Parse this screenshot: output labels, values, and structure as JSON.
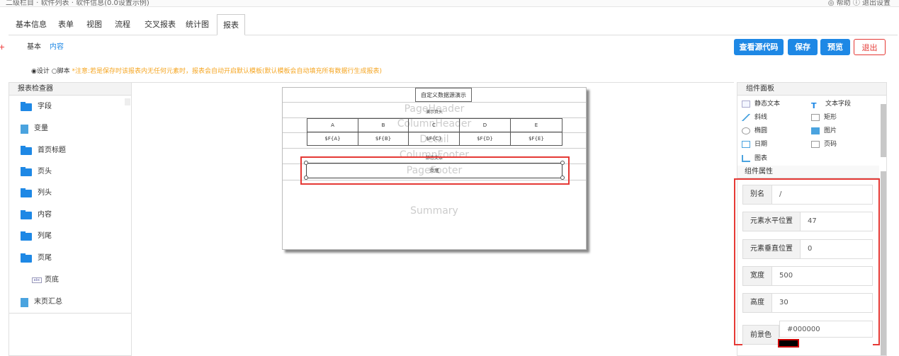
{
  "topbar": {
    "crumb": "二级栏目 · 软件列表 · 软件信息(0.0设置示例)",
    "right": "◎ 帮助 ⓘ 退出设置"
  },
  "side_mark": "+",
  "tabs": [
    "基本信息",
    "表单",
    "视图",
    "流程",
    "交叉报表",
    "统计图",
    "报表"
  ],
  "active_tab": "报表",
  "subtabs": [
    "基本",
    "内容"
  ],
  "buttons": {
    "source": "查看源代码",
    "save": "保存",
    "preview": "预览",
    "exit": "退出"
  },
  "mode": {
    "design": "◉设计",
    "script": "○脚本",
    "notice": "*注意:若是保存时该报表内无任何元素时，报表会自动开启默认模板(默认模板会自动填充所有数据行生成报表)"
  },
  "inspector": {
    "title": "报表检查器",
    "items": [
      {
        "label": "字段",
        "icon": "folder-icon"
      },
      {
        "label": "变量",
        "icon": "document-icon"
      },
      {
        "label": "首页标题",
        "icon": "folder-icon"
      },
      {
        "label": "页头",
        "icon": "folder-icon"
      },
      {
        "label": "列头",
        "icon": "folder-icon"
      },
      {
        "label": "内容",
        "icon": "folder-icon"
      },
      {
        "label": "列尾",
        "icon": "folder-icon"
      },
      {
        "label": "页尾",
        "icon": "open-folder-icon"
      },
      {
        "label": "页底",
        "icon": "text-field-icon"
      },
      {
        "label": "末页汇总",
        "icon": "document-icon"
      }
    ]
  },
  "report": {
    "title": "自定义数据源演示",
    "bands": [
      "PageHeader",
      "ColumnHeader",
      "Detail",
      "ColumnFooter",
      "PageFooter",
      "Summary"
    ],
    "page_header_text": "演示页头",
    "headers": [
      "A",
      "B",
      "C",
      "D",
      "E"
    ],
    "fields": [
      "$F{A}",
      "$F{B}",
      "$F{C}",
      "$F{D}",
      "$F{E}"
    ],
    "column_footer_text": "静态文本",
    "selected_text": "页底"
  },
  "component_panel": {
    "title": "组件面板",
    "items": [
      {
        "label": "静态文本",
        "icon": "static-text-icon"
      },
      {
        "label": "文本字段",
        "icon": "text-field-icon"
      },
      {
        "label": "斜线",
        "icon": "line-icon"
      },
      {
        "label": "矩形",
        "icon": "rectangle-icon"
      },
      {
        "label": "椭圆",
        "icon": "ellipse-icon"
      },
      {
        "label": "图片",
        "icon": "image-icon"
      },
      {
        "label": "日期",
        "icon": "date-icon"
      },
      {
        "label": "页码",
        "icon": "page-number-icon"
      },
      {
        "label": "图表",
        "icon": "chart-icon"
      }
    ]
  },
  "properties": {
    "title": "组件属性",
    "rows": [
      {
        "label": "别名",
        "value": "/"
      },
      {
        "label": "元素水平位置",
        "value": "47"
      },
      {
        "label": "元素垂直位置",
        "value": "0"
      },
      {
        "label": "宽度",
        "value": "500"
      },
      {
        "label": "高度",
        "value": "30"
      },
      {
        "label": "前景色",
        "value": "#000000"
      }
    ]
  },
  "colors": {
    "accent": "#1e88e5",
    "danger": "#e53935",
    "notice": "#f5a623"
  }
}
